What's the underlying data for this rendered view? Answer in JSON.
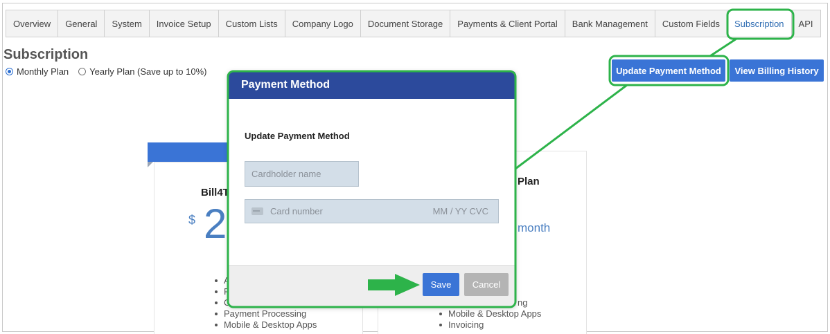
{
  "tabs": [
    {
      "label": "Overview"
    },
    {
      "label": "General"
    },
    {
      "label": "System"
    },
    {
      "label": "Invoice Setup"
    },
    {
      "label": "Custom Lists"
    },
    {
      "label": "Company Logo"
    },
    {
      "label": "Document Storage"
    },
    {
      "label": "Payments & Client Portal"
    },
    {
      "label": "Bank Management"
    },
    {
      "label": "Custom Fields"
    },
    {
      "label": "Subscription",
      "active": true
    },
    {
      "label": "API"
    }
  ],
  "page": {
    "title": "Subscription",
    "plan_options": [
      {
        "label": "Monthly Plan",
        "selected": true
      },
      {
        "label": "Yearly Plan (Save up to 10%)",
        "selected": false
      }
    ],
    "update_payment_label": "Update Payment Method",
    "billing_history_label": "View Billing History"
  },
  "cards": {
    "left": {
      "name_partial": "Bill4T",
      "currency": "$",
      "price_partial": "2",
      "features_partial": [
        "A",
        "F",
        "C",
        "Payment Processing",
        "Mobile & Desktop Apps"
      ]
    },
    "right": {
      "name_partial": "Plan",
      "per_month_partial": "month",
      "features_partial": [
        "ng",
        "Mobile & Desktop Apps",
        "Invoicing"
      ]
    }
  },
  "modal": {
    "title": "Payment Method",
    "subtitle": "Update Payment Method",
    "cardholder_placeholder": "Cardholder name",
    "card_number_placeholder": "Card number",
    "card_extra_placeholder": "MM / YY  CVC",
    "save_label": "Save",
    "cancel_label": "Cancel"
  },
  "colors": {
    "accent_blue": "#3a74d6",
    "modal_header": "#2c4a9c",
    "annotation_green": "#2db34a"
  }
}
